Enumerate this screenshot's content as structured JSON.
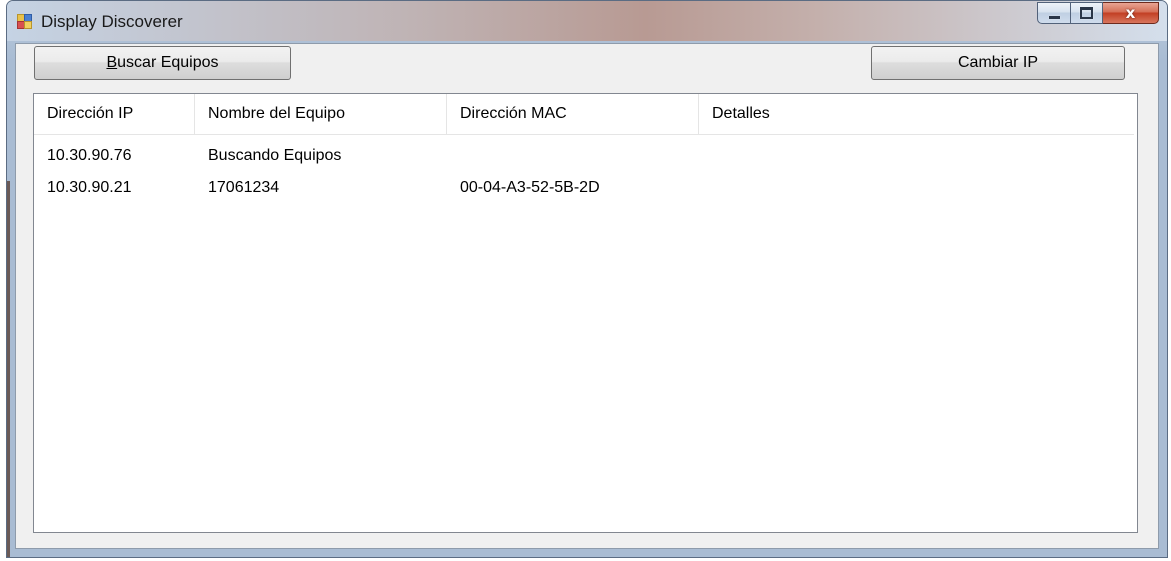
{
  "window": {
    "title": "Display Discoverer",
    "icon": "app-window-icon",
    "controls": {
      "minimize_icon": "minimize-icon",
      "maximize_icon": "maximize-icon",
      "close_label": "x"
    }
  },
  "toolbar": {
    "buscar_mnemonic": "B",
    "buscar_rest": "uscar Equipos",
    "cambiar_label": "Cambiar IP"
  },
  "listview": {
    "columns": [
      "Dirección IP",
      "Nombre del Equipo",
      "Dirección MAC",
      "Detalles"
    ],
    "rows": [
      [
        "10.30.90.76",
        "Buscando Equipos",
        "",
        ""
      ],
      [
        "10.30.90.21",
        "17061234",
        "00-04-A3-52-5B-2D",
        ""
      ]
    ]
  }
}
